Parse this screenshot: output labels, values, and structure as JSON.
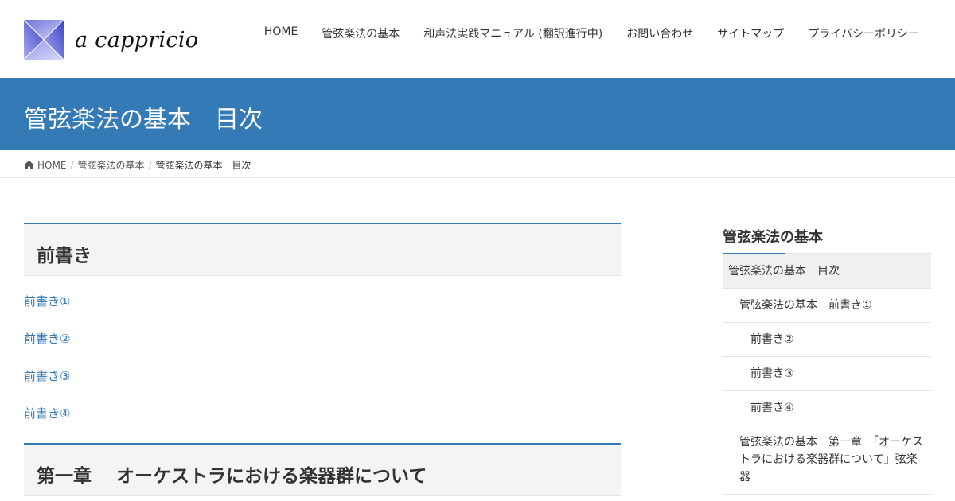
{
  "site": {
    "name": "a cappricio"
  },
  "nav": {
    "items": [
      "HOME",
      "管弦楽法の基本",
      "和声法実践マニュアル (翻訳進行中)",
      "お問い合わせ",
      "サイトマップ",
      "プライバシーポリシー"
    ]
  },
  "page": {
    "title": "管弦楽法の基本　目次"
  },
  "breadcrumb": {
    "home": "HOME",
    "parent": "管弦楽法の基本",
    "current": "管弦楽法の基本　目次"
  },
  "main": {
    "sections": [
      {
        "heading": "前書き",
        "links": [
          "前書き①",
          "前書き②",
          "前書き③",
          "前書き④"
        ]
      },
      {
        "heading": "第一章　 オーケストラにおける楽器群について"
      }
    ]
  },
  "sidebar": {
    "title": "管弦楽法の基本",
    "items": [
      "管弦楽法の基本　目次",
      "管弦楽法の基本　前書き①",
      "前書き②",
      "前書き③",
      "前書き④",
      "管弦楽法の基本　第一章　「オーケストラにおける楽器群について」弦楽器"
    ]
  },
  "colors": {
    "accent": "#337ab7",
    "link": "#337ab7"
  },
  "icons": {
    "breadcrumb_home": "home-icon"
  }
}
